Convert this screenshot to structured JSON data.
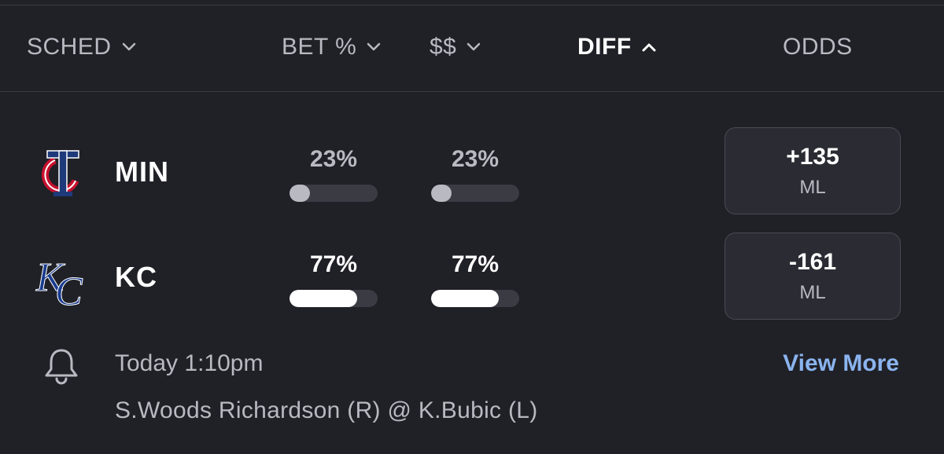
{
  "header": {
    "columns": [
      {
        "label": "SCHED",
        "icon": "chevron-down-icon"
      },
      {
        "label": "BET %",
        "icon": "chevron-down-icon"
      },
      {
        "label": "$$",
        "icon": "chevron-down-icon"
      },
      {
        "label": "DIFF",
        "icon": "chevron-up-icon",
        "active": true
      },
      {
        "label": "ODDS"
      }
    ]
  },
  "teams": [
    {
      "abbr": "MIN",
      "logo": "twins-logo-icon",
      "bet_pct": "23%",
      "bet_fraction": 0.23,
      "money_pct": "23%",
      "money_fraction": 0.23,
      "odds": {
        "value": "+135",
        "type": "ML"
      }
    },
    {
      "abbr": "KC",
      "logo": "royals-logo-icon",
      "bet_pct": "77%",
      "bet_fraction": 0.77,
      "money_pct": "77%",
      "money_fraction": 0.77,
      "odds": {
        "value": "-161",
        "type": "ML"
      }
    }
  ],
  "game": {
    "time": "Today 1:10pm",
    "pitchers": "S.Woods Richardson (R) @ K.Bubic (L)",
    "view_more": "View More",
    "bell_icon": "bell-icon"
  },
  "colors": {
    "background": "#202027",
    "bar_track": "#3b3b44",
    "bar_low": "#b9b9c2",
    "bar_high": "#ffffff",
    "link": "#8ab4ee"
  }
}
